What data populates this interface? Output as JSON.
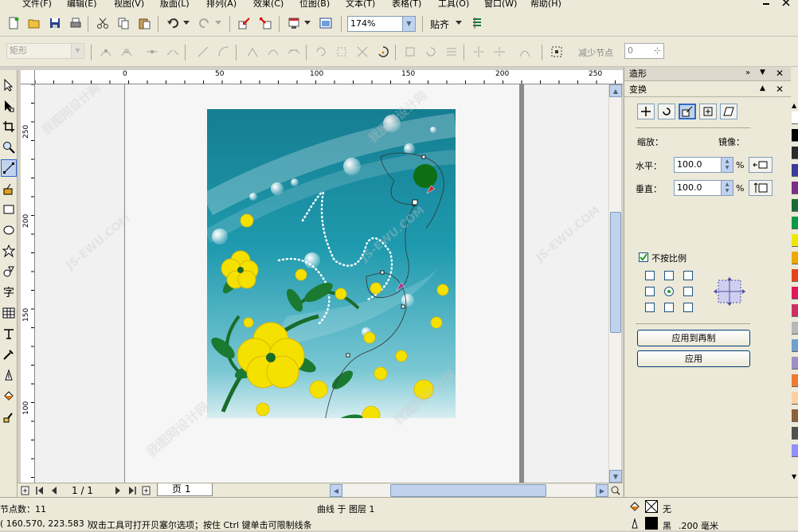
{
  "menubar": {
    "items": [
      "文件(F)",
      "编辑(E)",
      "视图(V)",
      "版面(L)",
      "排列(A)",
      "效果(C)",
      "位图(B)",
      "文本(T)",
      "表格(T)",
      "工具(O)",
      "窗口(W)",
      "帮助(H)"
    ]
  },
  "standard_toolbar": {
    "zoom_value": "174%",
    "snap_label": "贴齐"
  },
  "property_bar": {
    "object_type": "矩形",
    "reduce_nodes_label": "减少节点",
    "reduce_nodes_value": "0"
  },
  "ruler": {
    "h_labels": [
      "0",
      "50",
      "100",
      "150",
      "200",
      "250"
    ],
    "v_labels": [
      "250",
      "200",
      "150",
      "100"
    ]
  },
  "docker": {
    "top_title": "造形",
    "panel_title": "变换",
    "scale_label": "缩放：",
    "mirror_label": "镜像：",
    "horizontal_label": "水平：",
    "horizontal_value": "100.0",
    "vertical_label": "垂直：",
    "vertical_value": "100.0",
    "percent": "%",
    "nonproportional_label": "不按比例",
    "apply_to_duplicate": "应用到再制",
    "apply": "应用"
  },
  "page_nav": {
    "page_count": "1 / 1",
    "page_tab": "页 1"
  },
  "status": {
    "node_count": "节点数：11",
    "object_info": "曲线 于 图层 1",
    "coordinates": "( 160.570, 223.583 )",
    "hint": "双击工具可打开贝塞尔选项；按住 Ctrl 键单击可限制线条",
    "fill_label": "无",
    "outline_color": "黑",
    "outline_width": ".200 毫米"
  },
  "watermark": {
    "text_cn": "我图网设计网",
    "text_en": "JS-EWU.COM"
  },
  "colors": {
    "accent": "#316ac5",
    "artwork_teal": "#1e94a8",
    "flower_yellow": "#f5e100",
    "leaf_green": "#1a6b2a"
  },
  "palette": [
    "#ffffff",
    "#000000",
    "#2b2b2b",
    "#3c3c9c",
    "#7b2d8b",
    "#1b6b35",
    "#0a9a48",
    "#f2e600",
    "#f0a800",
    "#e8421a",
    "#e0195a",
    "#d03060",
    "#b8b8b8",
    "#6fa0d0",
    "#a090c8",
    "#f07a30",
    "#fbd0a0",
    "#8c6038",
    "#505050",
    "#9090ff"
  ]
}
